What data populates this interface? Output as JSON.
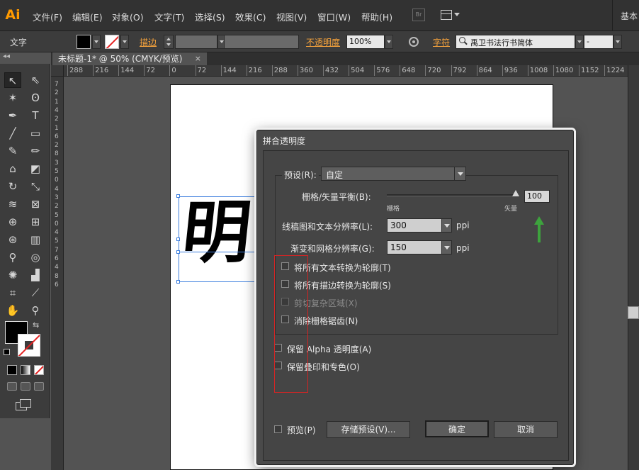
{
  "app": {
    "logo": "Ai",
    "menu": [
      "文件(F)",
      "编辑(E)",
      "对象(O)",
      "文字(T)",
      "选择(S)",
      "效果(C)",
      "视图(V)",
      "窗口(W)",
      "帮助(H)"
    ],
    "bridge_badge": "Br",
    "workspace_label": "基本"
  },
  "control_bar": {
    "tool_name": "文字",
    "stroke_label": "描边",
    "opacity_label": "不透明度",
    "opacity_value": "100%",
    "character_label": "字符",
    "font_family": "禹卫书法行书简体",
    "font_style": "-"
  },
  "document": {
    "tab_title": "未标题-1* @ 50% (CMYK/预览)",
    "close_glyph": "×",
    "collapse_glyph": "◂◂",
    "ruler_h_ticks": [
      "288",
      "216",
      "144",
      "72",
      "0",
      "72",
      "144",
      "216",
      "288",
      "360",
      "432",
      "504",
      "576",
      "648",
      "720",
      "792",
      "864",
      "936",
      "1008",
      "1080",
      "1152",
      "1224"
    ],
    "ruler_v_ticks": [
      "7",
      "2",
      "1",
      "4",
      "2",
      "1",
      "6",
      "2",
      "8",
      "3",
      "5",
      "0",
      "4",
      "3",
      "2",
      "5",
      "0",
      "4",
      "5",
      "7",
      "6",
      "4",
      "8",
      "6"
    ],
    "artwork_text": "明"
  },
  "dialog": {
    "title": "拼合透明度",
    "preset_label": "预设(R):",
    "preset_value": "自定",
    "raster_vector_label": "栅格/矢量平衡(B):",
    "raster_end": "栅格",
    "vector_end": "矢量",
    "raster_vector_value": "100",
    "raster_vector_level": 100,
    "line_res_label": "线稿图和文本分辨率(L):",
    "line_res_value": "300",
    "line_res_unit": "ppi",
    "gradient_res_label": "渐变和网格分辨率(G):",
    "gradient_res_value": "150",
    "gradient_res_unit": "ppi",
    "options": [
      {
        "label": "将所有文本转换为轮廓(T)",
        "checked": false,
        "disabled": false
      },
      {
        "label": "将所有描边转换为轮廓(S)",
        "checked": false,
        "disabled": false
      },
      {
        "label": "剪切复杂区域(X)",
        "checked": false,
        "disabled": true
      },
      {
        "label": "消除栅格锯齿(N)",
        "checked": false,
        "disabled": false
      }
    ],
    "preserve_alpha_label": "保留 Alpha 透明度(A)",
    "preserve_overprint_label": "保留叠印和专色(O)",
    "preview_label": "预览(P)",
    "save_preset_button": "存储预设(V)...",
    "ok_button": "确定",
    "cancel_button": "取消"
  },
  "colors": {
    "ai_orange": "#ff9a00",
    "label_orange": "#f4a23c",
    "annotation_red": "#d42424",
    "annotation_green": "#3da33d"
  }
}
